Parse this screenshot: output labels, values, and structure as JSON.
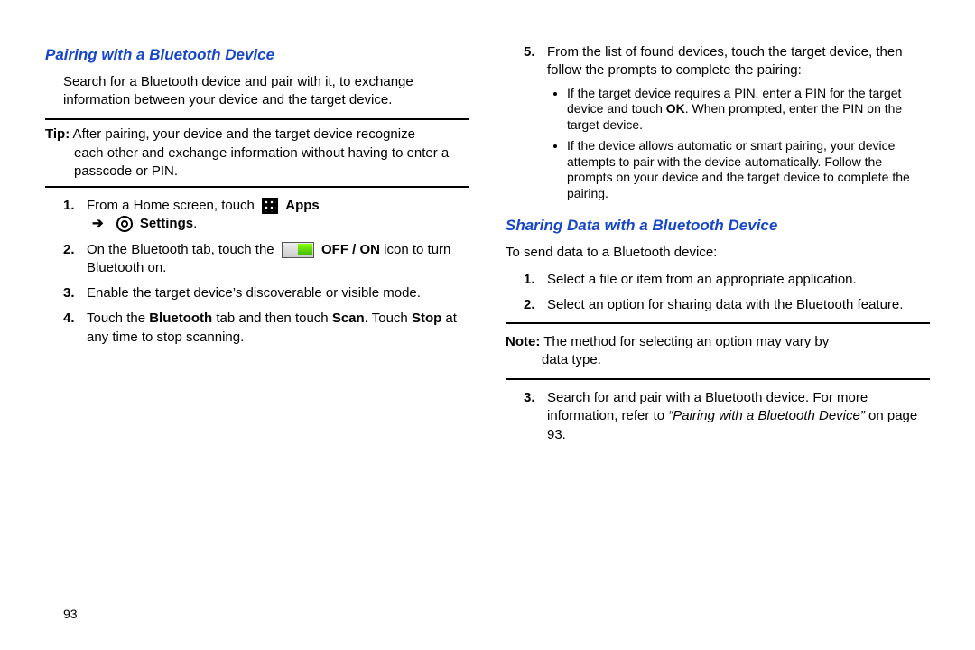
{
  "page_number": "93",
  "left": {
    "heading": "Pairing with a Bluetooth Device",
    "intro": "Search for a Bluetooth device and pair with it, to exchange information between your device and the target device.",
    "tip_label": "Tip:",
    "tip_text_a": " After pairing, your device and the target device recognize ",
    "tip_text_b": "each other and exchange information without having to enter a passcode or PIN.",
    "steps": {
      "s1_num": "1.",
      "s1_a": "From a Home screen, touch ",
      "s1_apps_label": "Apps",
      "s1_arrow": "➔",
      "s1_settings_label": "Settings",
      "s1_period": ".",
      "s2_num": "2.",
      "s2_a": "On the Bluetooth tab, touch the ",
      "s2_b": " OFF / ON",
      "s2_c": " icon to turn Bluetooth on.",
      "s3_num": "3.",
      "s3_a": "Enable the target device’s discoverable or visible mode.",
      "s4_num": "4.",
      "s4_a": "Touch the ",
      "s4_bt": "Bluetooth",
      "s4_b": " tab and then touch ",
      "s4_scan": "Scan",
      "s4_c": ". Touch ",
      "s4_stop": "Stop",
      "s4_d": " at any time to stop scanning."
    }
  },
  "right": {
    "s5_num": "5.",
    "s5_a": "From the list of found devices, touch the target device, then follow the prompts to complete the pairing:",
    "b1_a": "If the target device requires a PIN, enter a PIN for the target device and touch ",
    "b1_ok": "OK",
    "b1_b": ". When prompted, enter the PIN on the target device.",
    "b2": "If the device allows automatic or smart pairing, your device attempts to pair with the device automatically. Follow the prompts on your device and the target device to complete the pairing.",
    "heading2": "Sharing Data with a Bluetooth Device",
    "intro2": "To send data to a Bluetooth device:",
    "share_steps": {
      "s1_num": "1.",
      "s1": "Select a file or item from an appropriate application.",
      "s2_num": "2.",
      "s2": "Select an option for sharing data with the Bluetooth feature."
    },
    "note_label": "Note:",
    "note_a": "The method for selecting an option may vary by ",
    "note_b": "data type.",
    "s3_num": "3.",
    "s3_a": "Search for and pair with a Bluetooth device. For more information, refer to ",
    "s3_ref": "“Pairing with a Bluetooth Device”",
    "s3_b": " on page 93."
  }
}
